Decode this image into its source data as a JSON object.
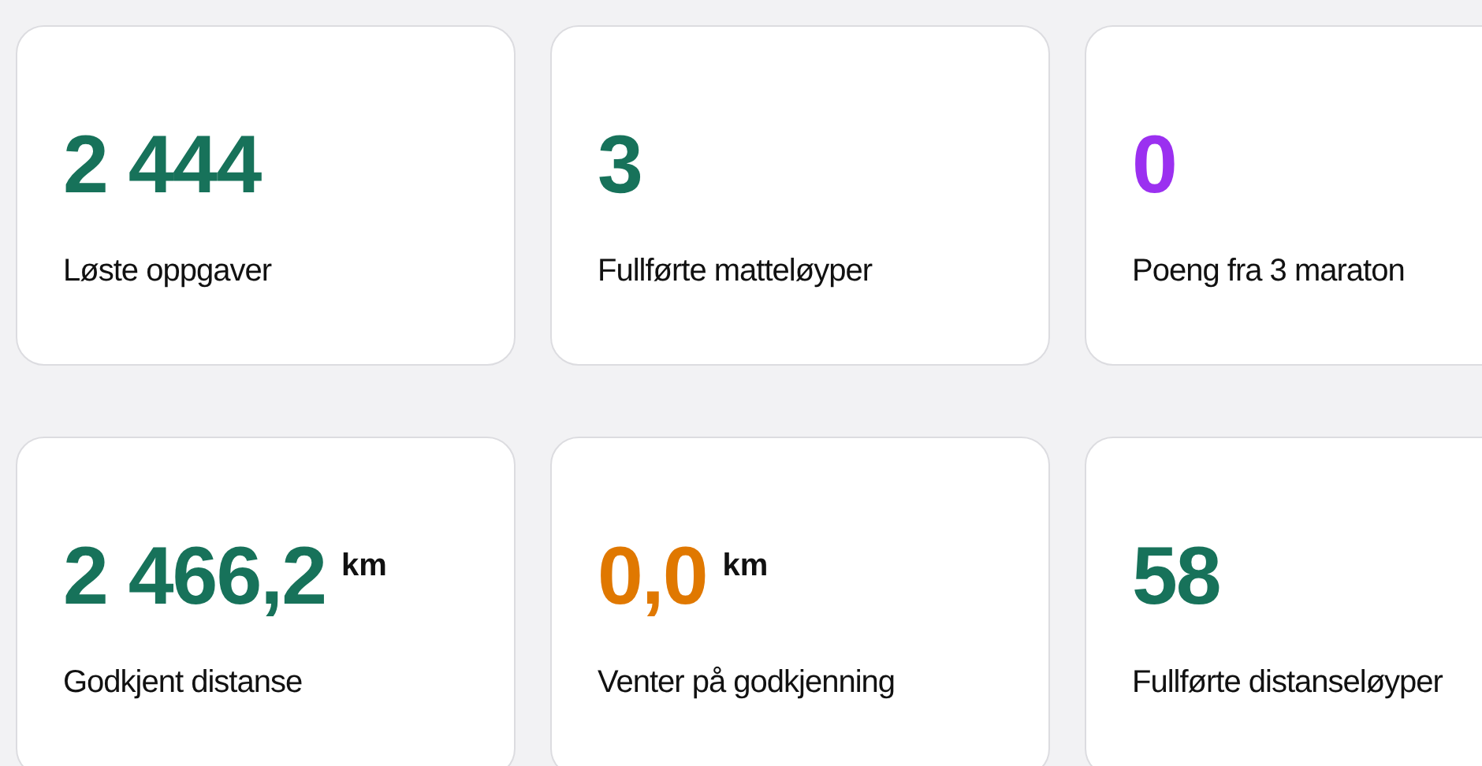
{
  "stats": [
    {
      "value": "2 444",
      "label": "Løste oppgaver",
      "color": "#17725a"
    },
    {
      "value": "3",
      "label": "Fullførte matteløyper",
      "color": "#17725a"
    },
    {
      "value": "0",
      "label": "Poeng fra 3 maraton",
      "color": "#9b30f0"
    },
    {
      "value": "2 466,2",
      "unit": "km",
      "label": "Godkjent distanse",
      "color": "#17725a"
    },
    {
      "value": "0,0",
      "unit": "km",
      "label": "Venter på godkjenning",
      "color": "#e07800"
    },
    {
      "value": "58",
      "label": "Fullførte distanseløyper",
      "color": "#17725a"
    }
  ]
}
